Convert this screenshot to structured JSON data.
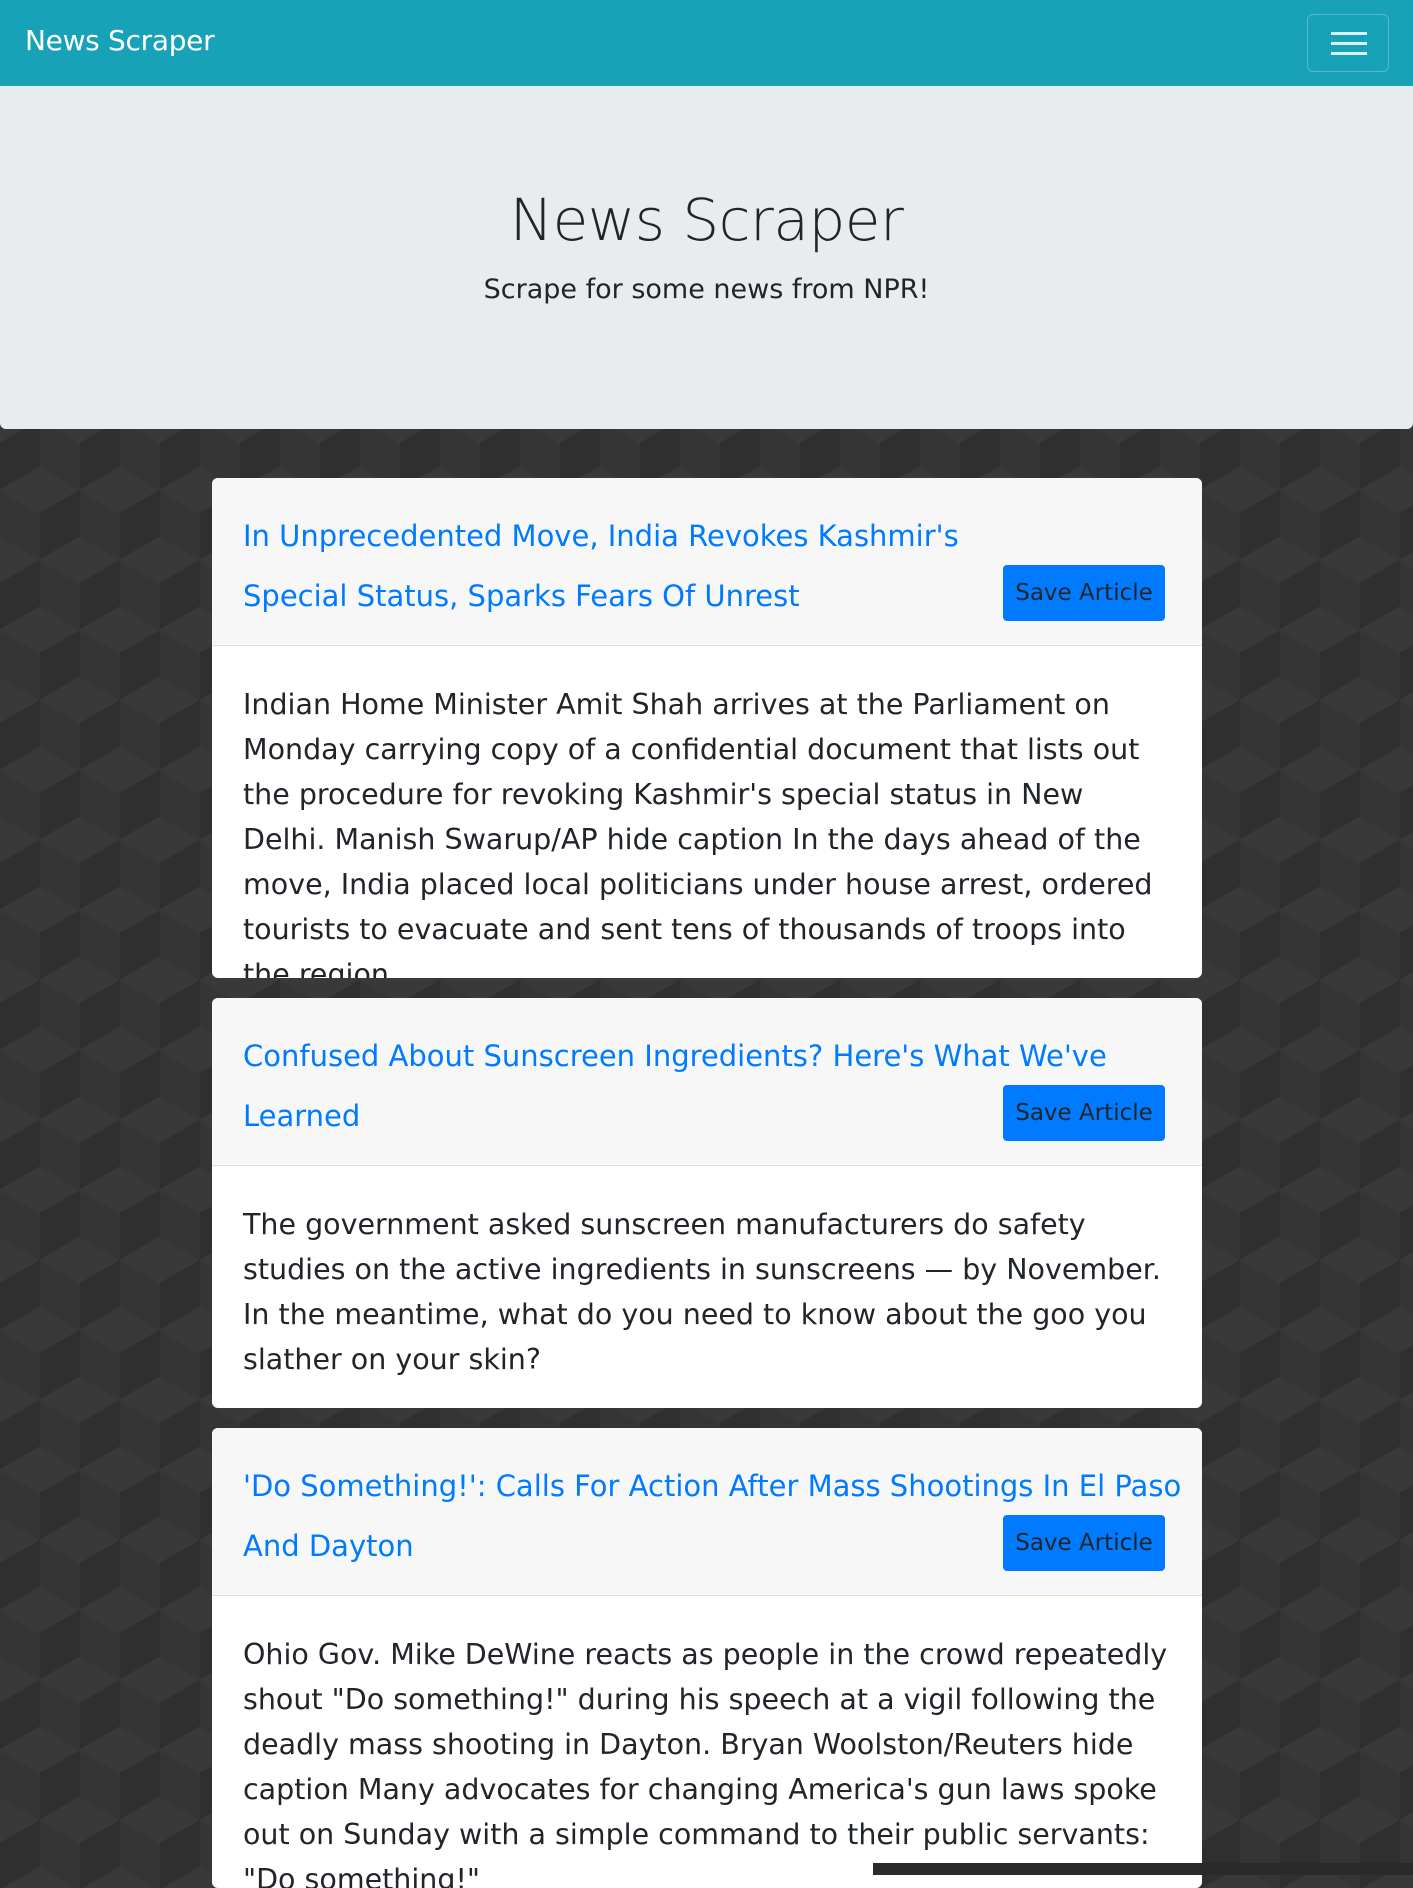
{
  "navbar": {
    "brand": "News Scraper",
    "toggle_icon": "hamburger-menu-icon",
    "bg_color": "#17a2b8"
  },
  "jumbotron": {
    "title": "News Scraper",
    "subtitle": "Scrape for some news from NPR!"
  },
  "articles": [
    {
      "title": "In Unprecedented Move, India Revokes Kashmir's Special Status, Sparks Fears Of Unrest",
      "save_label": "Save Article",
      "summary": "Indian Home Minister Amit Shah arrives at the Parliament on Monday carrying copy of a confidential document that lists out the procedure for revoking Kashmir's special status in New Delhi. Manish Swarup/AP hide caption In the days ahead of the move, India placed local politicians under house arrest, ordered tourists to evacuate and sent tens of thousands of troops into the region."
    },
    {
      "title": "Confused About Sunscreen Ingredients? Here's What We've Learned",
      "save_label": "Save Article",
      "summary": "The government asked sunscreen manufacturers do safety studies on the active ingredients in sunscreens — by November. In the meantime, what do you need to know about the goo you slather on your skin?"
    },
    {
      "title": "'Do Something!': Calls For Action After Mass Shootings In El Paso And Dayton",
      "save_label": "Save Article",
      "summary": "Ohio Gov. Mike DeWine reacts as people in the crowd repeatedly shout \"Do something!\" during his speech at a vigil following the deadly mass shooting in Dayton. Bryan Woolston/Reuters hide caption Many advocates for changing America's gun laws spoke out on Sunday with a simple command to their public servants: \"Do something!\""
    }
  ],
  "colors": {
    "link": "#007bff",
    "button": "#007bff",
    "jumbotron_bg": "#e9ecef",
    "page_bg": "#2f2f2f"
  }
}
